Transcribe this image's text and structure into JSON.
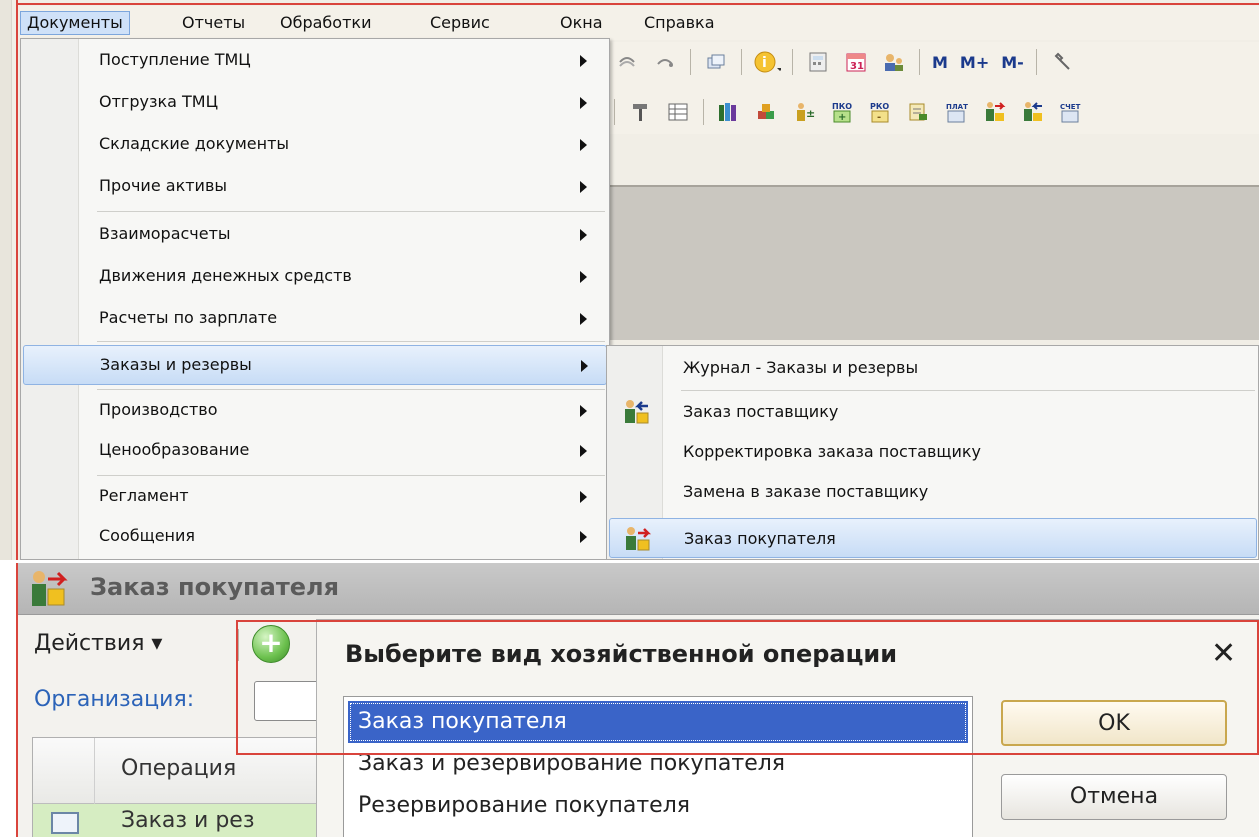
{
  "menubar": {
    "items": [
      {
        "label": "Документы",
        "active": true
      },
      {
        "label": "Отчеты"
      },
      {
        "label": "Обработки"
      },
      {
        "label": "Сервис"
      },
      {
        "label": "Окна"
      },
      {
        "label": "Справка"
      }
    ]
  },
  "toolbar": {
    "memory_buttons": [
      "M",
      "M+",
      "M-"
    ]
  },
  "documents_menu": {
    "items": [
      {
        "label": "Поступление ТМЦ"
      },
      {
        "label": "Отгрузка ТМЦ"
      },
      {
        "label": "Складские документы"
      },
      {
        "label": "Прочие активы"
      },
      {
        "label": "Взаиморасчеты"
      },
      {
        "label": "Движения денежных средств"
      },
      {
        "label": "Расчеты по зарплате"
      },
      {
        "label": "Заказы и резервы",
        "highlighted": true
      },
      {
        "label": "Производство"
      },
      {
        "label": "Ценообразование"
      },
      {
        "label": "Регламент"
      },
      {
        "label": "Сообщения"
      }
    ]
  },
  "orders_submenu": {
    "items": [
      {
        "label": "Журнал - Заказы и резервы"
      },
      {
        "label": "Заказ поставщику",
        "icon": "order-supplier-icon"
      },
      {
        "label": "Корректировка заказа поставщику"
      },
      {
        "label": "Замена в заказе поставщику"
      },
      {
        "label": "Заказ покупателя",
        "icon": "order-customer-icon",
        "highlighted": true
      }
    ]
  },
  "window": {
    "title": "Заказ покупателя",
    "actions_label": "Действия ▾",
    "organization_label": "Организация:",
    "grid_header": "Операция",
    "grid_row_text": "Заказ и рез"
  },
  "dialog": {
    "title": "Выберите вид хозяйственной операции",
    "close": "✕",
    "options": [
      {
        "label": "Заказ покупателя",
        "selected": true
      },
      {
        "label": "Заказ и резервирование покупателя"
      },
      {
        "label": "Резервирование покупателя"
      }
    ],
    "ok_label": "OK",
    "cancel_label": "Отмена"
  },
  "colors": {
    "highlight_red": "#d9443c",
    "selection_blue": "#3a64c8",
    "menu_hover": "#c7dcf6"
  }
}
